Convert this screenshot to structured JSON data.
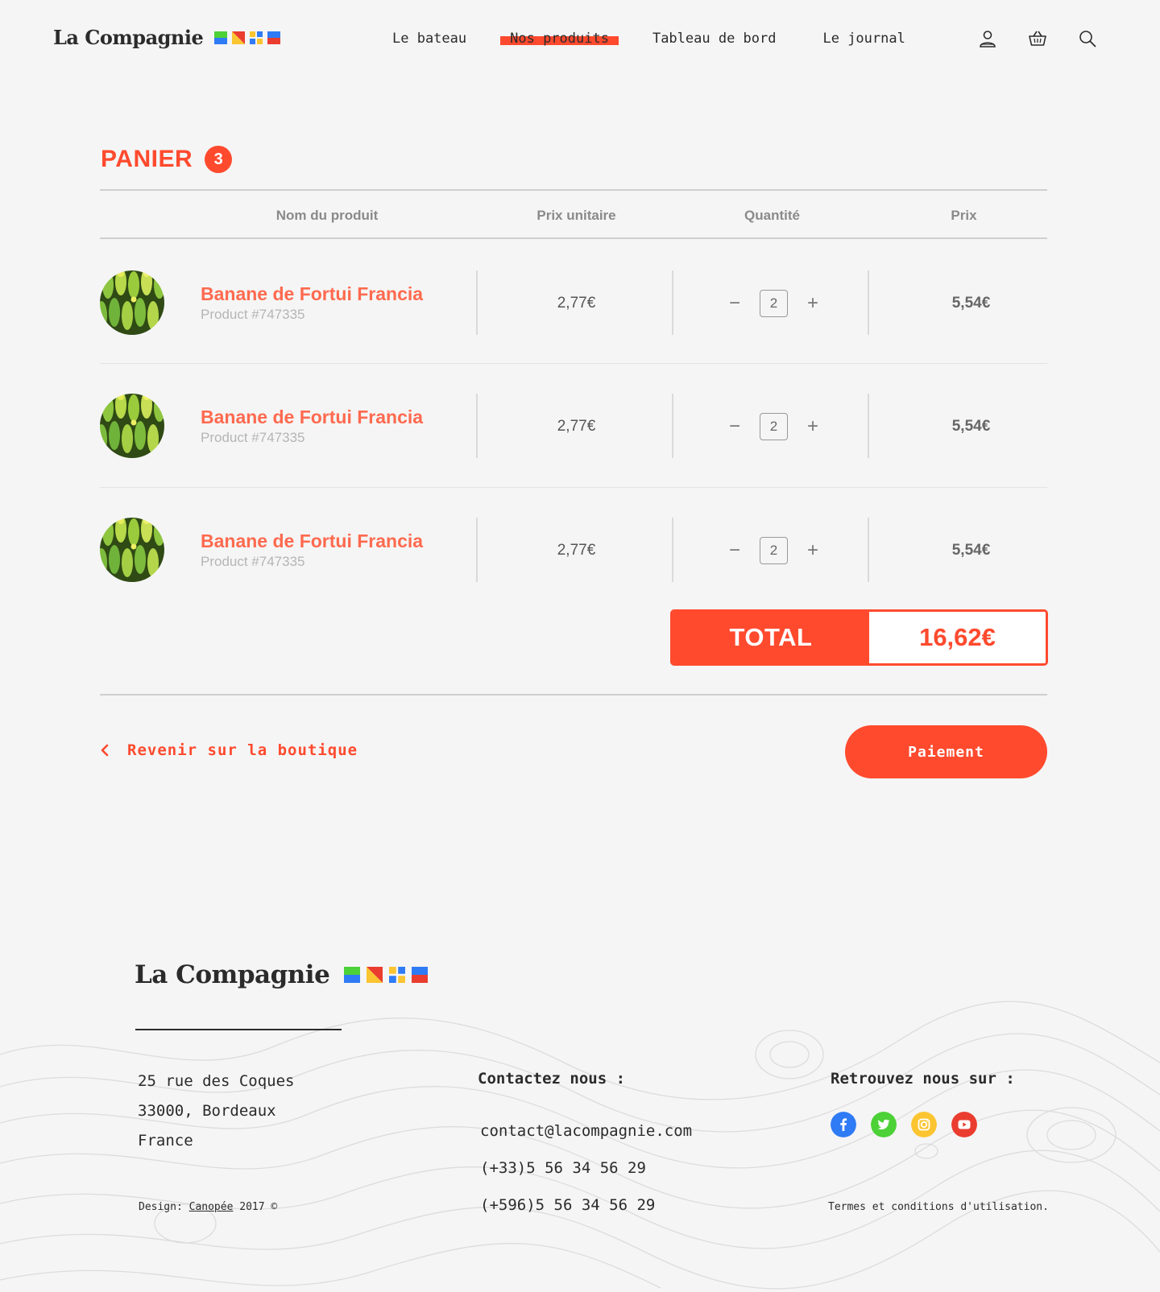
{
  "brand": {
    "name": "La Compagnie"
  },
  "nav": {
    "items": [
      {
        "label": "Le bateau"
      },
      {
        "label": "Nos produits",
        "active": true
      },
      {
        "label": "Tableau de bord"
      },
      {
        "label": "Le journal"
      }
    ],
    "icons": [
      "user-icon",
      "basket-icon",
      "search-icon"
    ]
  },
  "cart": {
    "title": "PANIER",
    "count": "3",
    "columns": {
      "product": "Nom du produit",
      "unit_price": "Prix unitaire",
      "quantity": "Quantité",
      "price": "Prix"
    },
    "items": [
      {
        "name": "Banane de Fortui Francia",
        "ref": "Product #747335",
        "unit_price": "2,77€",
        "quantity": "2",
        "price": "5,54€"
      },
      {
        "name": "Banane de Fortui Francia",
        "ref": "Product #747335",
        "unit_price": "2,77€",
        "quantity": "2",
        "price": "5,54€"
      },
      {
        "name": "Banane de Fortui Francia",
        "ref": "Product #747335",
        "unit_price": "2,77€",
        "quantity": "2",
        "price": "5,54€"
      }
    ],
    "total_label": "TOTAL",
    "total_value": "16,62€",
    "back_label": "Revenir sur la boutique",
    "pay_label": "Paiement",
    "qty_minus": "−",
    "qty_plus": "+"
  },
  "footer": {
    "brand": "La Compagnie",
    "address": [
      "25 rue des Coques",
      "33000, Bordeaux",
      "France"
    ],
    "contact_heading": "Contactez nous :",
    "contact": [
      "contact@lacompagnie.com",
      "(+33)5 56 34 56 29",
      "(+596)5 56 34 56 29"
    ],
    "social_heading": "Retrouvez nous sur :",
    "socials": [
      "facebook-icon",
      "twitter-icon",
      "instagram-icon",
      "youtube-icon"
    ],
    "credit_prefix": "Design: ",
    "credit_link": "Canopée",
    "credit_suffix": " 2017 ©",
    "terms": "Termes et conditions d'utilisation."
  },
  "colors": {
    "accent": "#ff4a2e",
    "blue": "#2f7bf5",
    "green": "#4cd137",
    "yellow": "#fbc531",
    "red": "#ea3d2f"
  }
}
